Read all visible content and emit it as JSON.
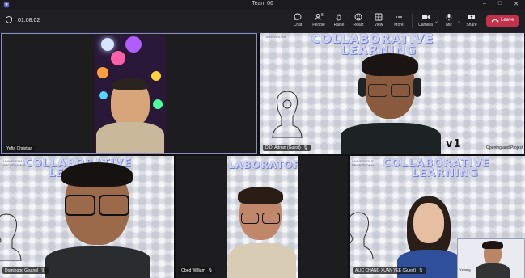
{
  "window": {
    "title": "Team 06",
    "minimize": "–",
    "maximize": "□",
    "close": "✕"
  },
  "meeting": {
    "timer": "01:08:02"
  },
  "toolbar": {
    "chat": "Chat",
    "people": "People",
    "people_count": "6",
    "raise": "Raise",
    "react": "React",
    "view": "View",
    "more": "More",
    "camera": "Camera",
    "mic": "Mic",
    "share": "Share",
    "leave": "Leave",
    "chevron": "⌄"
  },
  "colors": {
    "leave": "#c4314b",
    "active_border": "#8b8cc7"
  },
  "slide": {
    "title_line1": "COLLABORATIVE",
    "title_line2": "LEARNING",
    "laboratory_title": "LABORATORY",
    "uni1": "UNIVERSITAS",
    "uni2": "PROFESIONAL",
    "footer": "Opening and Project",
    "tag": "v1"
  },
  "participants": [
    {
      "name": "Yefta Christian"
    },
    {
      "name": "DIDI Adnan (Guest)"
    },
    {
      "name": "Dominggo Gisanol"
    },
    {
      "name": "Obed William"
    },
    {
      "name": "ALIC CHANG XUAN YEE (Guest)"
    }
  ],
  "small_tile": {
    "label": "Yzhong"
  }
}
